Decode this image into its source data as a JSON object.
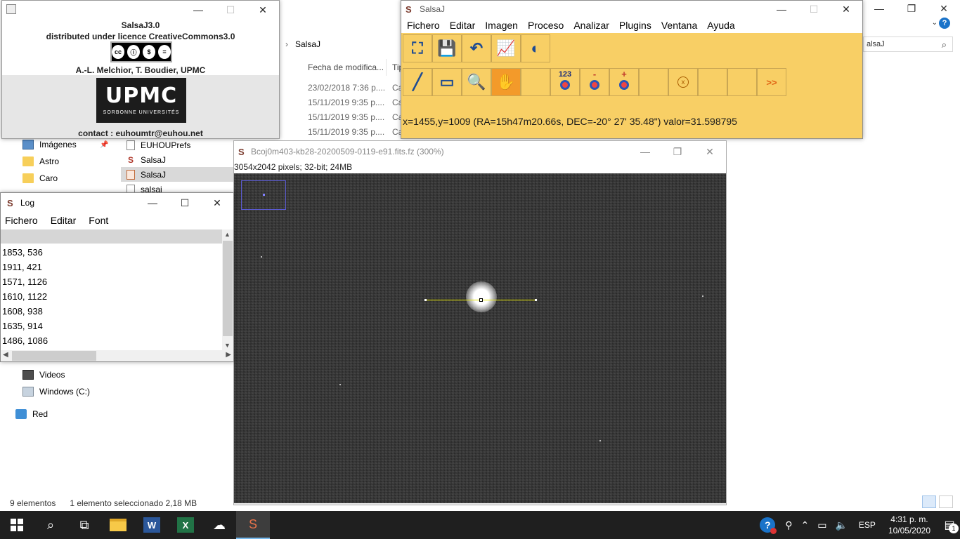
{
  "explorer": {
    "address_folder": "SalsaJ",
    "search_placeholder": "alsaJ",
    "columns": {
      "date": "Fecha de modifica...",
      "type": "Tip"
    },
    "date_cells": [
      "23/02/2018 7:36 p....",
      "15/11/2019 9:35 p....",
      "15/11/2019 9:35 p....",
      "15/11/2019 9:35 p...."
    ],
    "type_cells": [
      "Ca",
      "Ca",
      "Ca",
      "Ca"
    ],
    "nav": {
      "imagenes": "Imágenes",
      "astro": "Astro",
      "caro": "Caro",
      "videos": "Videos",
      "windows": "Windows (C:)",
      "red": "Red"
    },
    "files": [
      "EUHOUPrefs",
      "SalsaJ",
      "SalsaJ",
      "salsaj"
    ],
    "status": {
      "count": "9 elementos",
      "selected": "1 elemento seleccionado  2,18 MB"
    }
  },
  "about": {
    "line1": "SalsaJ3.0",
    "line2": "distributed under licence CreativeCommons3.0",
    "cc_label": "BY NC ND",
    "authors": "A.-L. Melchior, T. Boudier, UPMC",
    "logo_big": "UPMC",
    "logo_small": "SORBONNE UNIVERSITÉS",
    "contact": "contact : euhoumtr@euhou.net"
  },
  "salsa": {
    "title": "SalsaJ",
    "menu": [
      "Fichero",
      "Editar",
      "Imagen",
      "Proceso",
      "Analizar",
      "Plugins",
      "Ventana",
      "Ayuda"
    ],
    "tools": {
      "counter_label": "123",
      "minus_label": "-",
      "plus_label": "+",
      "x_label": "x",
      "more_label": ">>"
    },
    "status": "x=1455,y=1009 (RA=15h47m20.66s,  DEC=-20° 27' 35.48\") valor=31.598795"
  },
  "fits": {
    "title": "Bcoj0m403-kb28-20200509-0119-e91.fits.fz (300%)",
    "info": "3054x2042 pixels; 32-bit; 24MB"
  },
  "log": {
    "title": "Log",
    "menu": [
      "Fichero",
      "Editar",
      "Font"
    ],
    "rows": [
      "1853, 536",
      "1911, 421",
      "1571, 1126",
      "1610, 1122",
      "1608, 938",
      "1635, 914",
      "1486, 1086"
    ]
  },
  "taskbar": {
    "lang": "ESP",
    "time": "4:31 p. m.",
    "date": "10/05/2020",
    "notif_count": "1",
    "word_label": "W",
    "excel_label": "X"
  },
  "colors": {
    "salsa_bg": "#f8cf65",
    "tool_active": "#f39a2a",
    "profile_line": "#e6e600"
  }
}
